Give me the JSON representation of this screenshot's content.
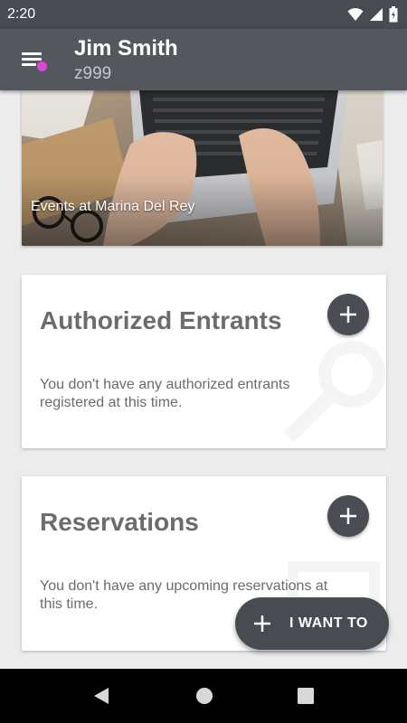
{
  "status_bar": {
    "time": "2:20",
    "icons": [
      "wifi-icon",
      "signal-icon",
      "battery-icon"
    ]
  },
  "app_bar": {
    "user_name": "Jim Smith",
    "user_id": "z999",
    "menu_icon": "menu-icon",
    "notification_dot_color": "#d64ad7"
  },
  "hero": {
    "caption": "Events at Marina Del Rey"
  },
  "cards": {
    "authorized_entrants": {
      "title": "Authorized Entrants",
      "message": "You don't have any authorized entrants registered at this time.",
      "add_icon": "plus-icon"
    },
    "reservations": {
      "title": "Reservations",
      "message": "You don't have any upcoming reservations at this time.",
      "add_icon": "plus-icon"
    }
  },
  "fab": {
    "label": "I WANT TO",
    "icon": "plus-icon"
  },
  "nav_bar": {
    "buttons": [
      "back-icon",
      "home-icon",
      "recents-icon"
    ]
  },
  "colors": {
    "app_bar": "#55575f",
    "status_bar": "#494b53",
    "accent": "#4b4d55"
  }
}
